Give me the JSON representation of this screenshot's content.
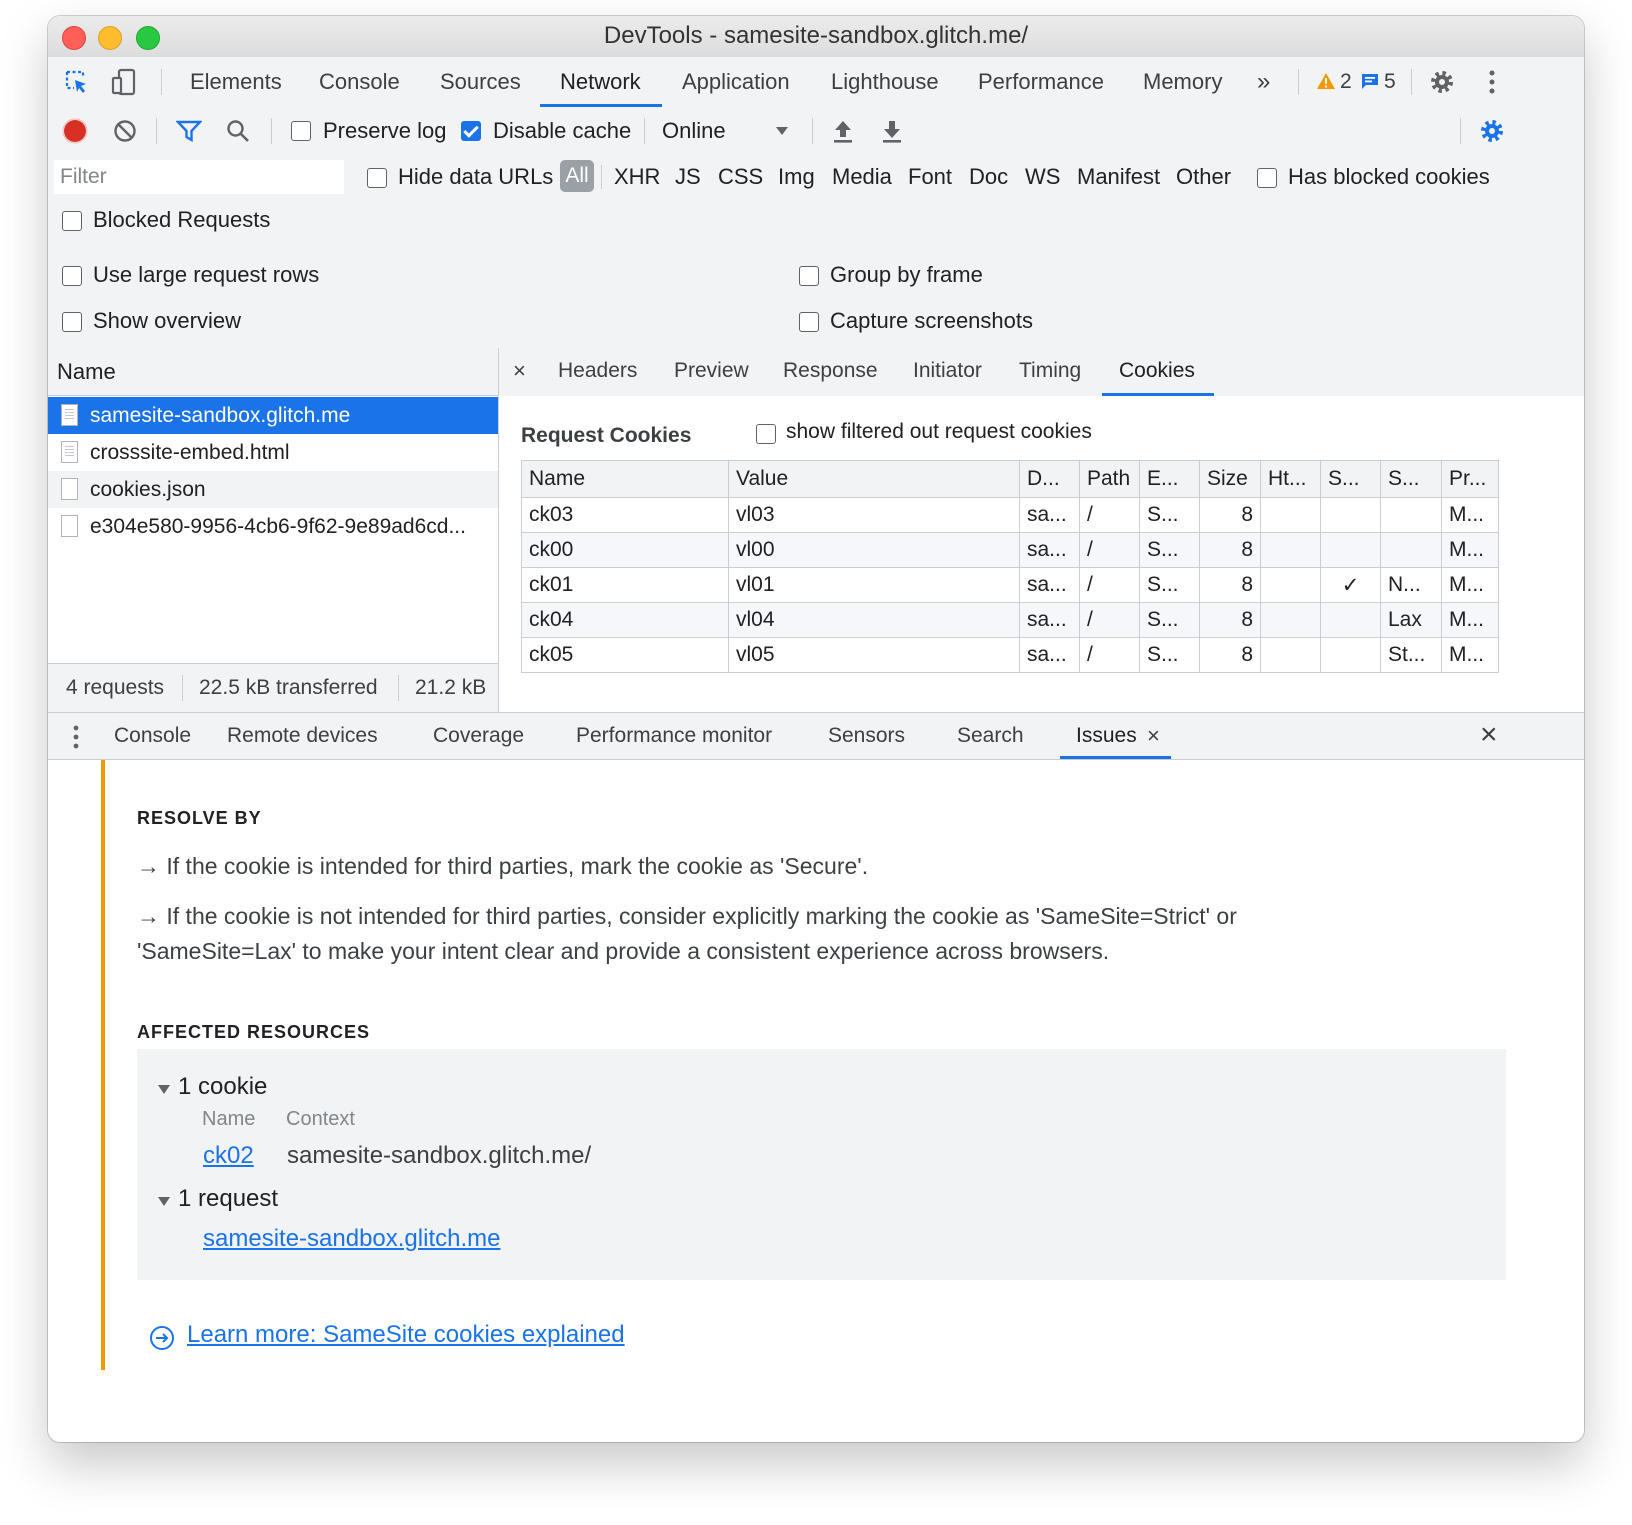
{
  "window": {
    "title": "DevTools - samesite-sandbox.glitch.me/"
  },
  "main_tabs": {
    "items": [
      "Elements",
      "Console",
      "Sources",
      "Network",
      "Application",
      "Lighthouse",
      "Performance",
      "Memory"
    ],
    "active": "Network",
    "more": "»",
    "warning_count": "2",
    "message_count": "5"
  },
  "network_toolbar": {
    "preserve_log": "Preserve log",
    "disable_cache": "Disable cache",
    "throttling": "Online"
  },
  "filter_bar": {
    "placeholder": "Filter",
    "hide_data_urls": "Hide data URLs",
    "types": [
      "All",
      "XHR",
      "JS",
      "CSS",
      "Img",
      "Media",
      "Font",
      "Doc",
      "WS",
      "Manifest",
      "Other"
    ],
    "has_blocked_cookies": "Has blocked cookies",
    "blocked_requests": "Blocked Requests"
  },
  "settings": {
    "use_large_rows": "Use large request rows",
    "group_by_frame": "Group by frame",
    "show_overview": "Show overview",
    "capture_screenshots": "Capture screenshots"
  },
  "request_list": {
    "header": "Name",
    "rows": [
      "samesite-sandbox.glitch.me",
      "crosssite-embed.html",
      "cookies.json",
      "e304e580-9956-4cb6-9f62-9e89ad6cd..."
    ],
    "status": {
      "requests": "4 requests",
      "transferred": "22.5 kB transferred",
      "resources": "21.2 kB"
    }
  },
  "detail_tabs": {
    "close": "×",
    "items": [
      "Headers",
      "Preview",
      "Response",
      "Initiator",
      "Timing",
      "Cookies"
    ],
    "active": "Cookies"
  },
  "cookies": {
    "section_title": "Request Cookies",
    "show_filtered": "show filtered out request cookies",
    "columns": [
      "Name",
      "Value",
      "D...",
      "Path",
      "E...",
      "Size",
      "Ht...",
      "S...",
      "S...",
      "Pr..."
    ],
    "rows": [
      [
        "ck03",
        "vl03",
        "sa...",
        "/",
        "S...",
        "8",
        "",
        "",
        "",
        "M..."
      ],
      [
        "ck00",
        "vl00",
        "sa...",
        "/",
        "S...",
        "8",
        "",
        "",
        "",
        "M..."
      ],
      [
        "ck01",
        "vl01",
        "sa...",
        "/",
        "S...",
        "8",
        "",
        "✓",
        "N...",
        "M..."
      ],
      [
        "ck04",
        "vl04",
        "sa...",
        "/",
        "S...",
        "8",
        "",
        "",
        "Lax",
        "M..."
      ],
      [
        "ck05",
        "vl05",
        "sa...",
        "/",
        "S...",
        "8",
        "",
        "",
        "St...",
        "M..."
      ]
    ]
  },
  "drawer_tabs": {
    "items": [
      "Console",
      "Remote devices",
      "Coverage",
      "Performance monitor",
      "Sensors",
      "Search",
      "Issues"
    ],
    "active": "Issues",
    "tab_close": "×",
    "close": "×"
  },
  "issue": {
    "resolve_by": "RESOLVE BY",
    "line1": "→ If the cookie is intended for third parties, mark the cookie as 'Secure'.",
    "line2a": "→ If the cookie is not intended for third parties, consider explicitly marking the cookie as 'SameSite=Strict' or",
    "line2b": "'SameSite=Lax' to make your intent clear and provide a consistent experience across browsers.",
    "affected": "AFFECTED RESOURCES",
    "cookie_group": "1 cookie",
    "col_name": "Name",
    "col_context": "Context",
    "cookie_name": "ck02",
    "cookie_context": "samesite-sandbox.glitch.me/",
    "request_group": "1 request",
    "request_link": "samesite-sandbox.glitch.me",
    "learn_more": "Learn more: SameSite cookies explained"
  },
  "colors": {
    "accent": "#1a73e8",
    "warning": "#f29900",
    "record": "#d93025"
  }
}
